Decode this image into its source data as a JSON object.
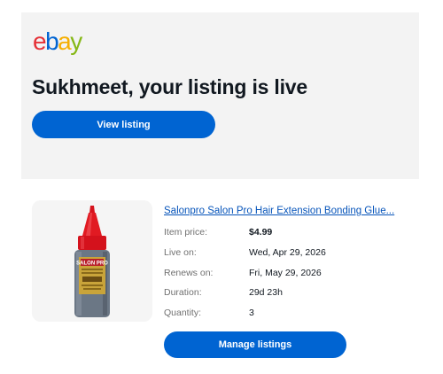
{
  "brand": {
    "logo_letters": [
      "e",
      "b",
      "a",
      "y"
    ],
    "colors": {
      "red": "#e53238",
      "blue": "#0064d2",
      "yellow": "#f5af02",
      "green": "#86b817"
    }
  },
  "header": {
    "headline": "Sukhmeet, your listing is live",
    "view_button_label": "View listing"
  },
  "listing": {
    "image_icon": "hair-glue-bottle-image",
    "title": "Salonpro Salon Pro Hair Extension Bonding Glue...",
    "details": [
      {
        "label": "Item price:",
        "value": "$4.99"
      },
      {
        "label": "Live on:",
        "value": "Wed, Apr 29, 2026"
      },
      {
        "label": "Renews on:",
        "value": "Fri, May 29, 2026"
      },
      {
        "label": "Duration:",
        "value": "29d 23h"
      },
      {
        "label": "Quantity:",
        "value": "3"
      }
    ],
    "manage_button_label": "Manage listings"
  },
  "accent_color": "#0064d2"
}
